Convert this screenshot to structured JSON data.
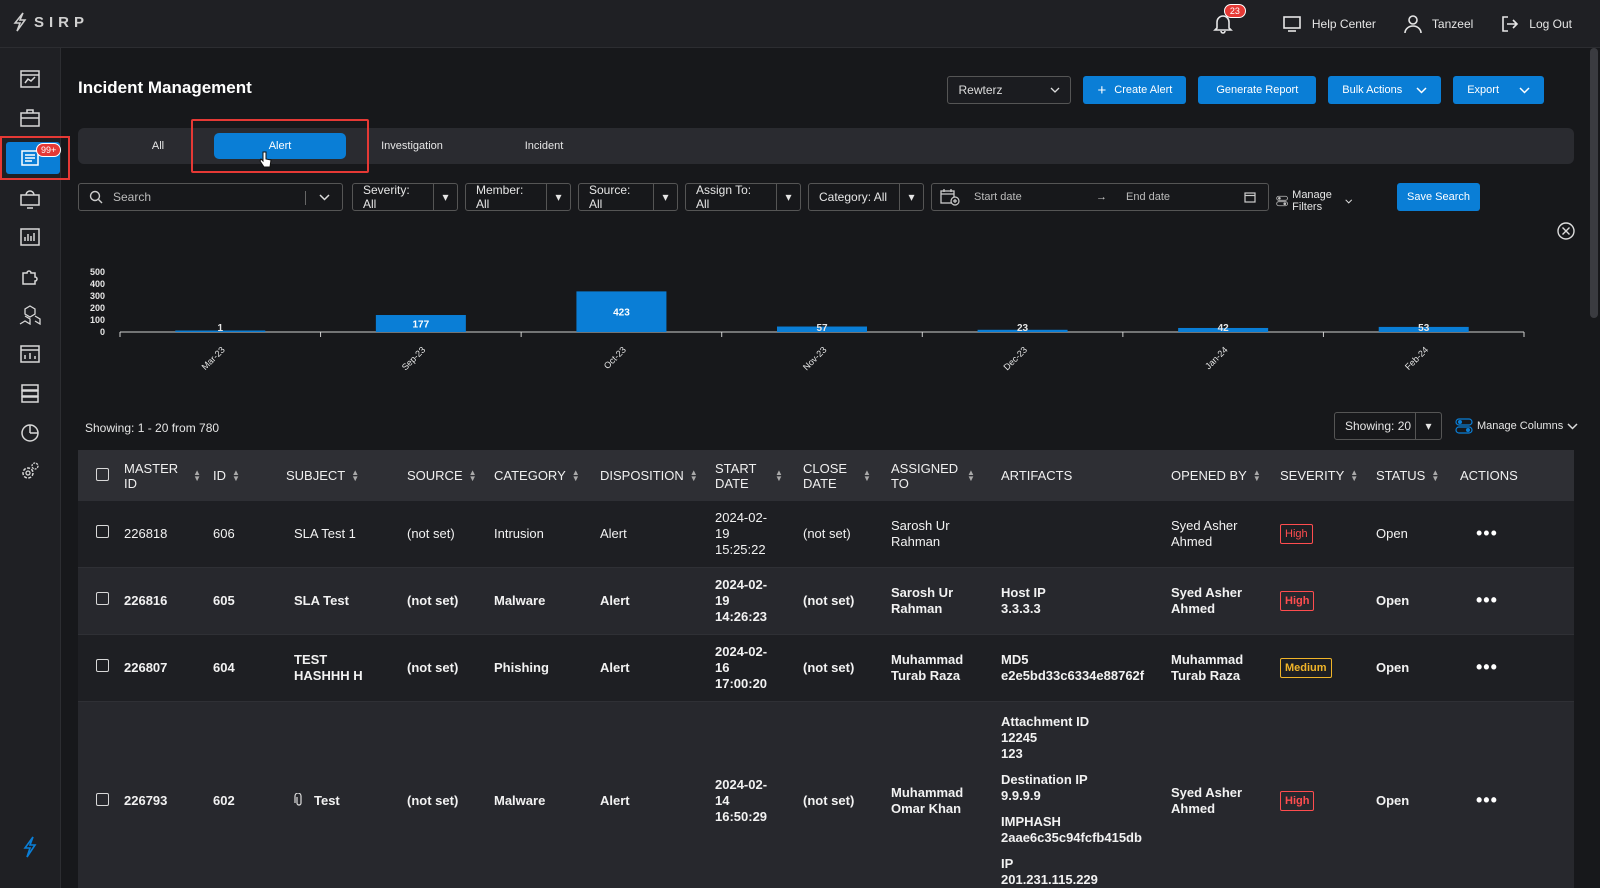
{
  "app": {
    "logo_text": "SIRP"
  },
  "topbar": {
    "notification_count": "23",
    "help_center": "Help Center",
    "user_name": "Tanzeel",
    "logout": "Log Out"
  },
  "sidebar": {
    "badge": "99+"
  },
  "page": {
    "title": "Incident Management"
  },
  "header": {
    "org_select": "Rewterz",
    "create_alert": "Create Alert",
    "generate_report": "Generate Report",
    "bulk_actions": "Bulk Actions",
    "export": "Export"
  },
  "tabs": [
    {
      "label": "All"
    },
    {
      "label": "Alert"
    },
    {
      "label": "Investigation"
    },
    {
      "label": "Incident"
    }
  ],
  "filters": {
    "search_placeholder": "Search",
    "severity": "Severity: All",
    "member": "Member: All",
    "source": "Source: All",
    "assign_to": "Assign To: All",
    "category": "Category: All",
    "start_date": "Start date",
    "end_date": "End date",
    "manage_filters": "Manage Filters",
    "save_search": "Save Search"
  },
  "chart_data": {
    "type": "bar",
    "categories": [
      "Mar-23",
      "Sep-23",
      "Oct-23",
      "Nov-23",
      "Dec-23",
      "Jan-24",
      "Feb-24"
    ],
    "values": [
      1,
      177,
      423,
      57,
      23,
      42,
      53
    ],
    "yticks": [
      "500",
      "400",
      "300",
      "200",
      "100",
      "0"
    ],
    "ylim": [
      0,
      500
    ],
    "color": "#0a7ed6"
  },
  "list": {
    "showing_text": "Showing: 1 - 20 from 780",
    "page_size": "Showing: 20",
    "manage_columns": "Manage Columns"
  },
  "table": {
    "columns": [
      "MASTER ID",
      "ID",
      "SUBJECT",
      "SOURCE",
      "CATEGORY",
      "DISPOSITION",
      "START DATE",
      "CLOSE DATE",
      "ASSIGNED TO",
      "ARTIFACTS",
      "OPENED BY",
      "SEVERITY",
      "STATUS",
      "ACTIONS"
    ],
    "rows": [
      {
        "master_id": "226818",
        "id": "606",
        "subject": "SLA Test 1",
        "source": "(not set)",
        "category": "Intrusion",
        "disposition": "Alert",
        "start_date_1": "2024-02-",
        "start_date_2": "19",
        "start_date_3": "15:25:22",
        "close_date": "(not set)",
        "assigned_1": "Sarosh Ur",
        "assigned_2": "Rahman",
        "artifacts": [],
        "opened_1": "Syed Asher",
        "opened_2": "Ahmed",
        "severity": "High",
        "status": "Open"
      },
      {
        "master_id": "226816",
        "id": "605",
        "subject": "SLA Test",
        "source": "(not set)",
        "category": "Malware",
        "disposition": "Alert",
        "start_date_1": "2024-02-",
        "start_date_2": "19",
        "start_date_3": "14:26:23",
        "close_date": "(not set)",
        "assigned_1": "Sarosh Ur",
        "assigned_2": "Rahman",
        "artifacts": [
          {
            "type": "Host IP",
            "values": [
              "3.3.3.3"
            ]
          }
        ],
        "opened_1": "Syed Asher",
        "opened_2": "Ahmed",
        "severity": "High",
        "status": "Open"
      },
      {
        "master_id": "226807",
        "id": "604",
        "subject": "TEST HASHHH H",
        "source": "(not set)",
        "category": "Phishing",
        "disposition": "Alert",
        "start_date_1": "2024-02-",
        "start_date_2": "16",
        "start_date_3": "17:00:20",
        "close_date": "(not set)",
        "assigned_1": "Muhammad",
        "assigned_2": "Turab Raza",
        "artifacts": [
          {
            "type": "MD5",
            "values": [
              "e2e5bd33c6334e88762f"
            ]
          }
        ],
        "opened_1": "Muhammad",
        "opened_2": "Turab Raza",
        "severity": "Medium",
        "status": "Open"
      },
      {
        "master_id": "226793",
        "id": "602",
        "subject": "Test",
        "source": "(not set)",
        "category": "Malware",
        "disposition": "Alert",
        "start_date_1": "2024-02-",
        "start_date_2": "14",
        "start_date_3": "16:50:29",
        "close_date": "(not set)",
        "assigned_1": "Muhammad",
        "assigned_2": "Omar Khan",
        "artifacts": [
          {
            "type": "Attachment ID",
            "values": [
              "12245",
              "123"
            ]
          },
          {
            "type": "Destination IP",
            "values": [
              "9.9.9.9"
            ]
          },
          {
            "type": "IMPHASH",
            "values": [
              "2aae6c35c94fcfb415db"
            ]
          },
          {
            "type": "IP",
            "values": [
              "201.231.115.229"
            ]
          }
        ],
        "opened_1": "Syed Asher",
        "opened_2": "Ahmed",
        "severity": "High",
        "status": "Open"
      }
    ]
  }
}
